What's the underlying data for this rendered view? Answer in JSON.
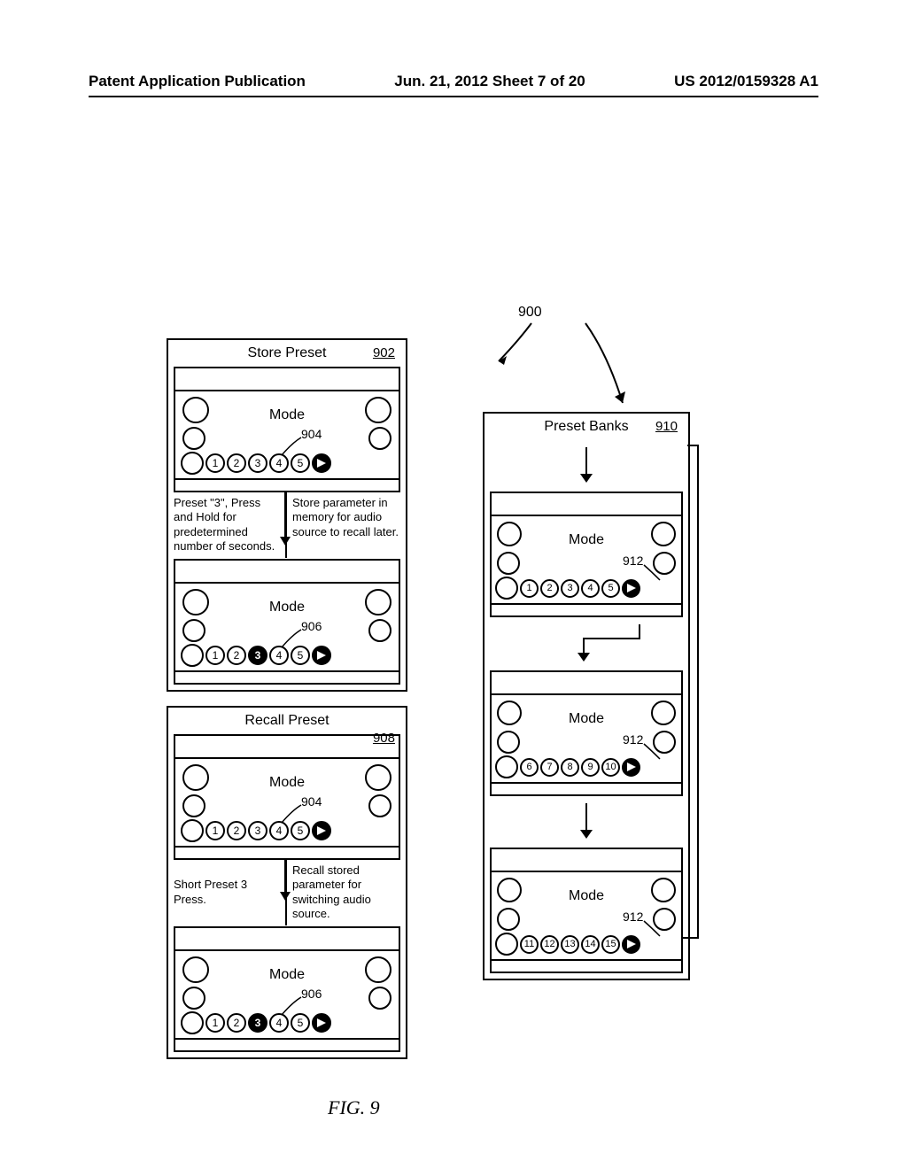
{
  "header": {
    "left": "Patent Application Publication",
    "center": "Jun. 21, 2012  Sheet 7 of 20",
    "right": "US 2012/0159328 A1"
  },
  "figure": {
    "topRef": "900",
    "caption": "FIG. 9"
  },
  "storePreset": {
    "title": "Store Preset",
    "ref": "902",
    "panel1": {
      "modeLabel": "Mode",
      "ref": "904",
      "presets": [
        "1",
        "2",
        "3",
        "4",
        "5"
      ],
      "active": -1
    },
    "betweenLeft": "Preset \"3\", Press and Hold for predetermined number of seconds.",
    "betweenRight": "Store parameter in memory for audio source to recall later.",
    "panel2": {
      "modeLabel": "Mode",
      "ref": "906",
      "presets": [
        "1",
        "2",
        "3",
        "4",
        "5"
      ],
      "active": 2
    }
  },
  "recallPreset": {
    "title": "Recall Preset",
    "ref": "908",
    "panel1": {
      "modeLabel": "Mode",
      "ref": "904",
      "presets": [
        "1",
        "2",
        "3",
        "4",
        "5"
      ],
      "active": -1
    },
    "betweenLeft": "Short Preset 3 Press.",
    "betweenRight": "Recall stored parameter for switching audio source.",
    "panel2": {
      "modeLabel": "Mode",
      "ref": "906",
      "presets": [
        "1",
        "2",
        "3",
        "4",
        "5"
      ],
      "active": 2
    }
  },
  "presetBanks": {
    "title": "Preset Banks",
    "ref": "910",
    "panel1": {
      "modeLabel": "Mode",
      "ref": "912",
      "presets": [
        "1",
        "2",
        "3",
        "4",
        "5"
      ]
    },
    "panel2": {
      "modeLabel": "Mode",
      "ref": "912",
      "presets": [
        "6",
        "7",
        "8",
        "9",
        "10"
      ]
    },
    "panel3": {
      "modeLabel": "Mode",
      "ref": "912",
      "presets": [
        "11",
        "12",
        "13",
        "14",
        "15"
      ]
    }
  }
}
